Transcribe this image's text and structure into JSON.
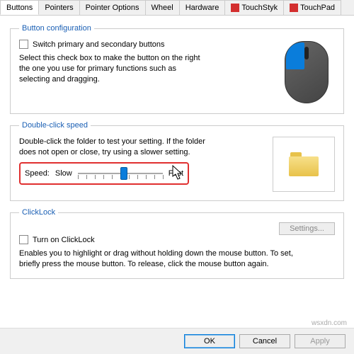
{
  "tabs": {
    "buttons": "Buttons",
    "pointers": "Pointers",
    "pointer_options": "Pointer Options",
    "wheel": "Wheel",
    "hardware": "Hardware",
    "touchstyk": "TouchStyk",
    "touchpad": "TouchPad"
  },
  "button_config": {
    "legend": "Button configuration",
    "switch_label": "Switch primary and secondary buttons",
    "desc": "Select this check box to make the button on the right the one you use for primary functions such as selecting and dragging."
  },
  "double_click": {
    "legend": "Double-click speed",
    "desc": "Double-click the folder to test your setting. If the folder does not open or close, try using a slower setting.",
    "speed_label": "Speed:",
    "slow": "Slow",
    "fast": "Fast"
  },
  "clicklock": {
    "legend": "ClickLock",
    "turn_on": "Turn on ClickLock",
    "settings": "Settings...",
    "desc": "Enables you to highlight or drag without holding down the mouse button. To set, briefly press the mouse button. To release, click the mouse button again."
  },
  "footer": {
    "ok": "OK",
    "cancel": "Cancel",
    "apply": "Apply"
  },
  "watermark": "wsxdn.com"
}
